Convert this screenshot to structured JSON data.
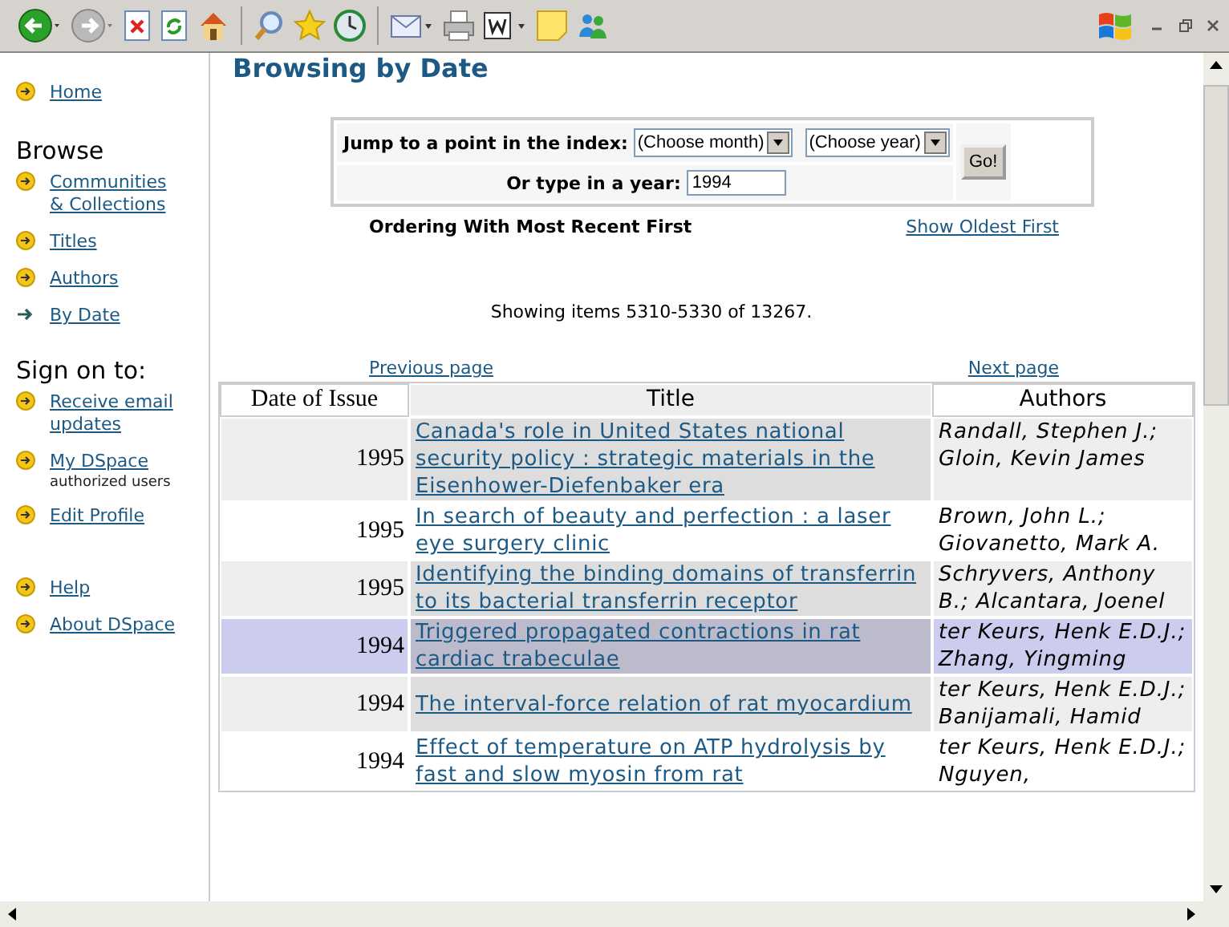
{
  "sidebar": {
    "home": {
      "label": "Home",
      "selected": false
    },
    "browse_heading": "Browse",
    "browse_items": [
      {
        "label": "Communities & Collections",
        "selected": false
      },
      {
        "label": "Titles",
        "selected": false
      },
      {
        "label": "Authors",
        "selected": false
      },
      {
        "label": "By Date",
        "selected": true
      }
    ],
    "sign_on_heading": "Sign on to:",
    "sign_on_items": [
      {
        "label": "Receive email updates"
      },
      {
        "label": "My DSpace",
        "note": "authorized users"
      },
      {
        "label": "Edit Profile"
      }
    ],
    "help_items": [
      {
        "label": "Help"
      },
      {
        "label": "About DSpace"
      }
    ]
  },
  "page_title": "Browsing by Date",
  "jump_form": {
    "jump_label": "Jump to a point in the index:",
    "month_select": "(Choose month)",
    "year_select": "(Choose year)",
    "type_label": "Or type in a year:",
    "year_value": "1994",
    "go_button": "Go!"
  },
  "ordering_text": "Ordering With Most Recent First",
  "order_link": "Show Oldest First",
  "showing_text": "Showing items 5310-5330 of 13267.",
  "previous_link": "Previous page",
  "next_link": "Next page",
  "table": {
    "columns": [
      "Date of Issue",
      "Title",
      "Authors"
    ],
    "rows": [
      {
        "date": "1995",
        "title": "Canada's role in United States national security policy : strategic materials in the Eisenhower-Diefenbaker era",
        "authors": "Randall, Stephen J.; Gloin, Kevin James",
        "highlighted": false
      },
      {
        "date": "1995",
        "title": "In search of beauty and perfection : a laser eye surgery clinic",
        "authors": "Brown, John L.; Giovanetto, Mark A.",
        "highlighted": false
      },
      {
        "date": "1995",
        "title": "Identifying the binding domains of transferrin to its bacterial transferrin receptor",
        "authors": "Schryvers, Anthony B.; Alcantara, Joenel",
        "highlighted": false
      },
      {
        "date": "1994",
        "title": "Triggered propagated contractions in rat cardiac trabeculae",
        "authors": "ter Keurs, Henk E.D.J.; Zhang, Yingming",
        "highlighted": true
      },
      {
        "date": "1994",
        "title": "The interval-force relation of rat myocardium",
        "authors": "ter Keurs, Henk E.D.J.; Banijamali, Hamid",
        "highlighted": false
      },
      {
        "date": "1994",
        "title": "Effect of temperature on ATP hydrolysis by fast and slow myosin from rat",
        "authors": "ter Keurs, Henk E.D.J.; Nguyen,",
        "highlighted": false
      }
    ]
  }
}
